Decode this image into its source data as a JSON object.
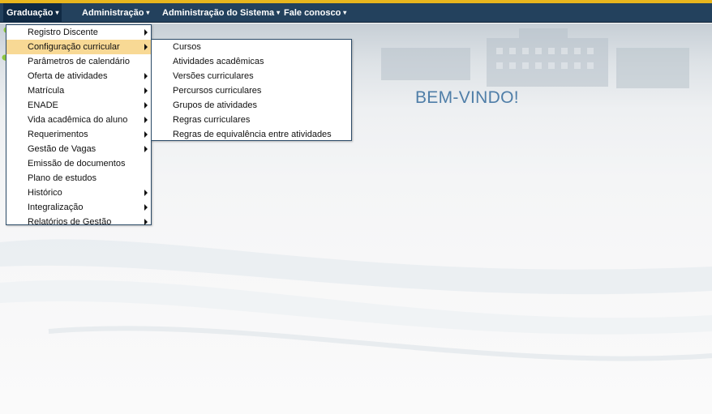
{
  "menubar": {
    "items": [
      {
        "label": "Graduação",
        "caret": "▾"
      },
      {
        "label": "Administração",
        "caret": "▾"
      },
      {
        "label": "Administração do Sistema",
        "caret": "▾"
      },
      {
        "label": "Fale conosco",
        "caret": "▾"
      }
    ]
  },
  "graduacao_menu": {
    "items": [
      {
        "label": "Registro Discente",
        "has_submenu": true
      },
      {
        "label": "Configuração curricular",
        "has_submenu": true,
        "highlighted": true
      },
      {
        "label": "Parâmetros de calendário",
        "has_submenu": false
      },
      {
        "label": "Oferta de atividades",
        "has_submenu": true
      },
      {
        "label": "Matrícula",
        "has_submenu": true
      },
      {
        "label": "ENADE",
        "has_submenu": true
      },
      {
        "label": "Vida acadêmica do aluno",
        "has_submenu": true
      },
      {
        "label": "Requerimentos",
        "has_submenu": true
      },
      {
        "label": "Gestão de Vagas",
        "has_submenu": true
      },
      {
        "label": "Emissão de documentos",
        "has_submenu": false
      },
      {
        "label": "Plano de estudos",
        "has_submenu": false
      },
      {
        "label": "Histórico",
        "has_submenu": true
      },
      {
        "label": "Integralização",
        "has_submenu": true
      },
      {
        "label": "Relatórios de Gestão",
        "has_submenu": true
      }
    ]
  },
  "configuracao_submenu": {
    "items": [
      {
        "label": "Cursos"
      },
      {
        "label": "Atividades acadêmicas"
      },
      {
        "label": "Versões curriculares"
      },
      {
        "label": "Percursos curriculares"
      },
      {
        "label": "Grupos de atividades"
      },
      {
        "label": "Regras curriculares"
      },
      {
        "label": "Regras de equivalência entre atividades"
      }
    ]
  },
  "banner": {
    "welcome_text": "BEM-VINDO!",
    "logo_icon": "ga-logo-icon"
  },
  "colors": {
    "menubar_bg": "#23415d",
    "accent_stripe": "#e8b61e",
    "highlight": "#f8d995",
    "welcome_text": "#4f7ea8",
    "logo_green": "#8dc63f",
    "logo_dark": "#1f3f5f"
  }
}
